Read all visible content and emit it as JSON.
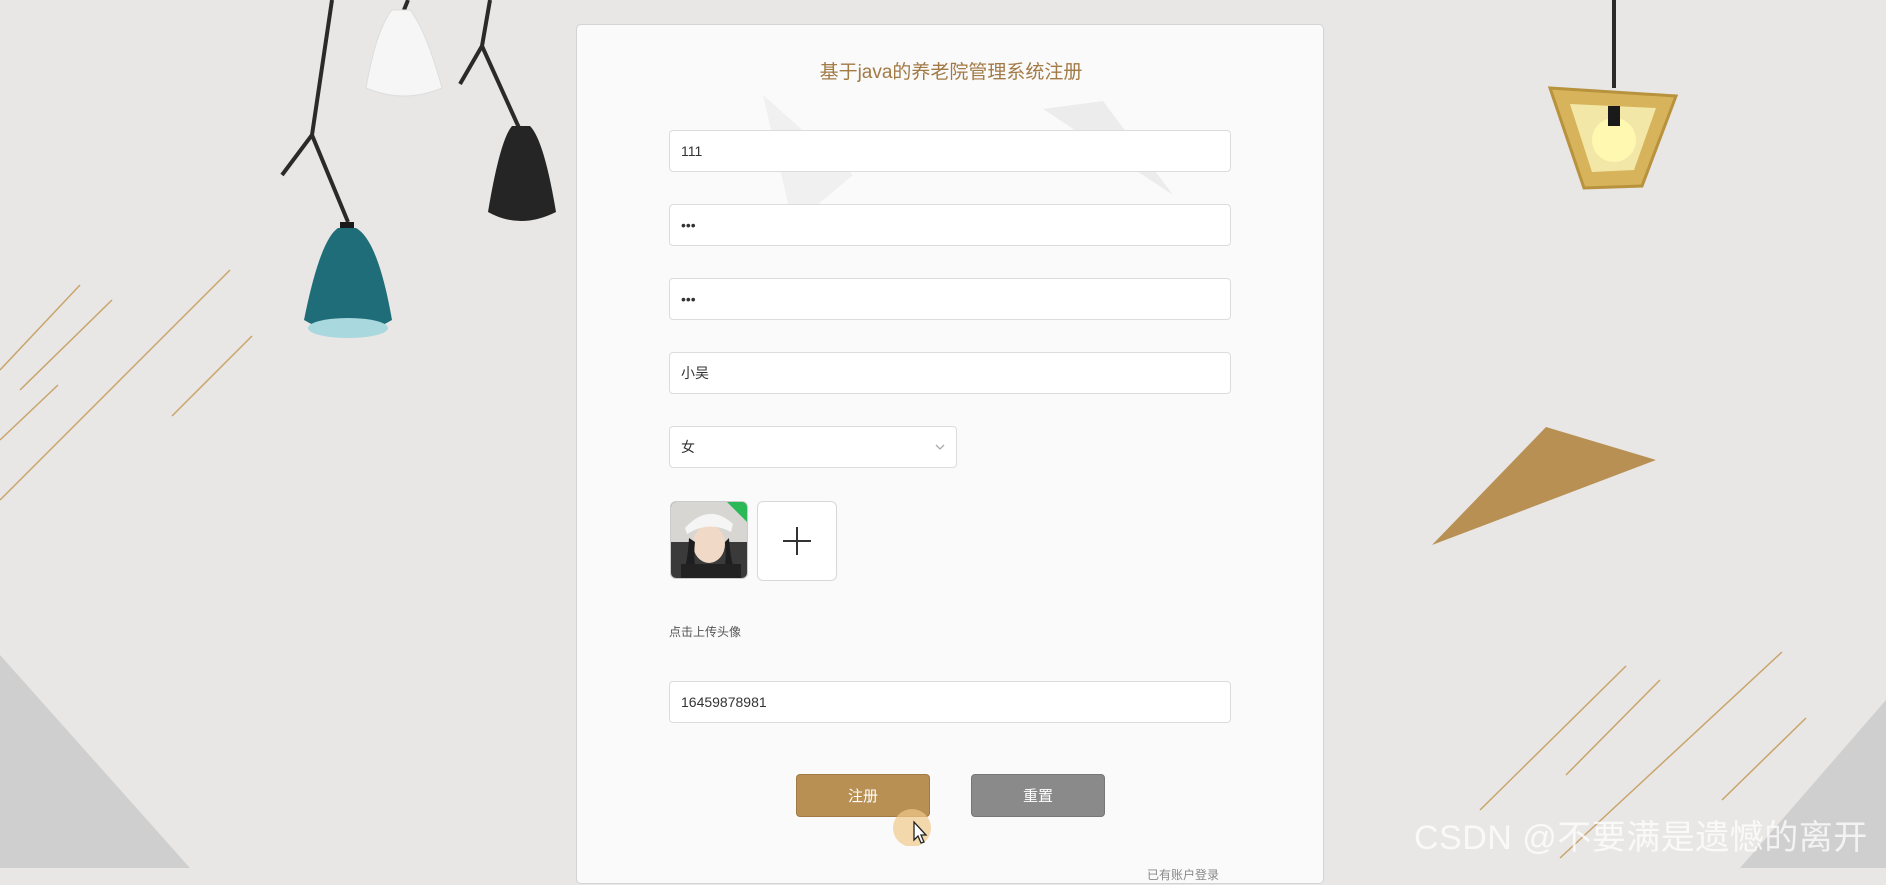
{
  "form": {
    "title": "基于java的养老院管理系统注册",
    "account_value": "111",
    "password_value": "•••",
    "confirm_password_value": "•••",
    "name_value": "小吴",
    "gender_value": "女",
    "upload_label": "点击上传头像",
    "phone_value": "16459878981"
  },
  "buttons": {
    "register_label": "注册",
    "reset_label": "重置",
    "login_link": "已有账户登录"
  },
  "watermark": "CSDN @不要满是遗憾的离开",
  "icons": {
    "select_arrow": "chevron-down-icon",
    "upload": "plus-icon",
    "cursor": "mouse-pointer-icon"
  },
  "colors": {
    "accent": "#b99053",
    "title": "#a27a45",
    "reset": "#8a8a8a",
    "background": "#e8e7e5"
  }
}
